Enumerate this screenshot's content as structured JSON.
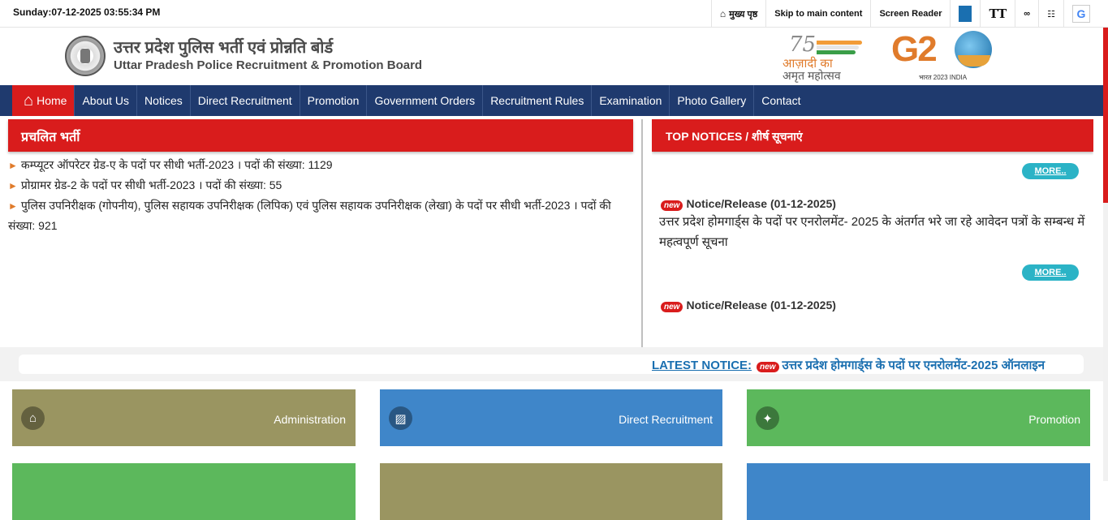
{
  "topbar": {
    "datetime": "Sunday:07-12-2025 03:55:34 PM",
    "home_link": "मुख्य पृष्ठ",
    "skip_link": "Skip to main content",
    "screen_reader": "Screen Reader",
    "text_size_icon_label": "TT"
  },
  "header": {
    "title_hindi": "उत्तर प्रदेश पुलिस भर्ती एवं प्रोन्नति बोर्ड",
    "title_english": "Uttar Pradesh Police Recruitment & Promotion Board",
    "azadi_number": "75",
    "azadi_line1": "आज़ादी का",
    "azadi_line2": "अमृत महोत्सव",
    "g20_text": "G2",
    "g20_sub": "भारत 2023 INDIA"
  },
  "nav": {
    "items": [
      {
        "label": "Home"
      },
      {
        "label": "About Us"
      },
      {
        "label": "Notices"
      },
      {
        "label": "Direct Recruitment"
      },
      {
        "label": "Promotion"
      },
      {
        "label": "Government Orders"
      },
      {
        "label": "Recruitment Rules"
      },
      {
        "label": "Examination"
      },
      {
        "label": "Photo Gallery"
      },
      {
        "label": "Contact"
      }
    ]
  },
  "vacancies": {
    "heading": "प्रचलित भर्ती",
    "items": [
      {
        "text": "कम्प्यूटर ऑपरेटर ग्रेड-ए के पदों पर सीधी भर्ती-2023 । पदों की संख्या: 1129"
      },
      {
        "text": "प्रोग्रामर ग्रेड-2 के पदों पर सीधी भर्ती-2023 । पदों की संख्या: 55"
      },
      {
        "text": "पुलिस उपनिरीक्षक (गोपनीय), पुलिस सहायक उपनिरीक्षक (लिपिक) एवं पुलिस सहायक उपनिरीक्षक (लेखा) के पदों पर सीधी भर्ती-2023 । पदों की संख्या: 921"
      }
    ]
  },
  "top_notices": {
    "heading": "TOP NOTICES / शीर्ष सूचनाएं",
    "more_label": "MORE..",
    "new_badge": "new",
    "items": [
      {
        "title": "Notice/Release (01-12-2025)",
        "desc": "उत्तर प्रदेश होमगार्ड्स के पदों पर एनरोलमेंट- 2025 के अंतर्गत भरे जा रहे आवेदन पत्रों के सम्बन्ध में महत्वपूर्ण सूचना"
      },
      {
        "title": "Notice/Release (01-12-2025)",
        "desc": ""
      }
    ]
  },
  "ticker": {
    "label": "LATEST NOTICE:",
    "new_badge": "new",
    "text": "उत्तर प्रदेश होमगार्ड्स के पदों पर एनरोलमेंट-2025 ऑनलाइन"
  },
  "tiles": [
    {
      "label": "Administration",
      "icon": "home-icon",
      "color": "#9a9561"
    },
    {
      "label": "Direct Recruitment",
      "icon": "id-card-icon",
      "color": "#3f86c9"
    },
    {
      "label": "Promotion",
      "icon": "medal-icon",
      "color": "#5cb85c"
    },
    {
      "label": "",
      "icon": "",
      "color": "#5cb85c"
    },
    {
      "label": "",
      "icon": "",
      "color": "#9a9561"
    },
    {
      "label": "",
      "icon": "",
      "color": "#3f86c9"
    }
  ]
}
